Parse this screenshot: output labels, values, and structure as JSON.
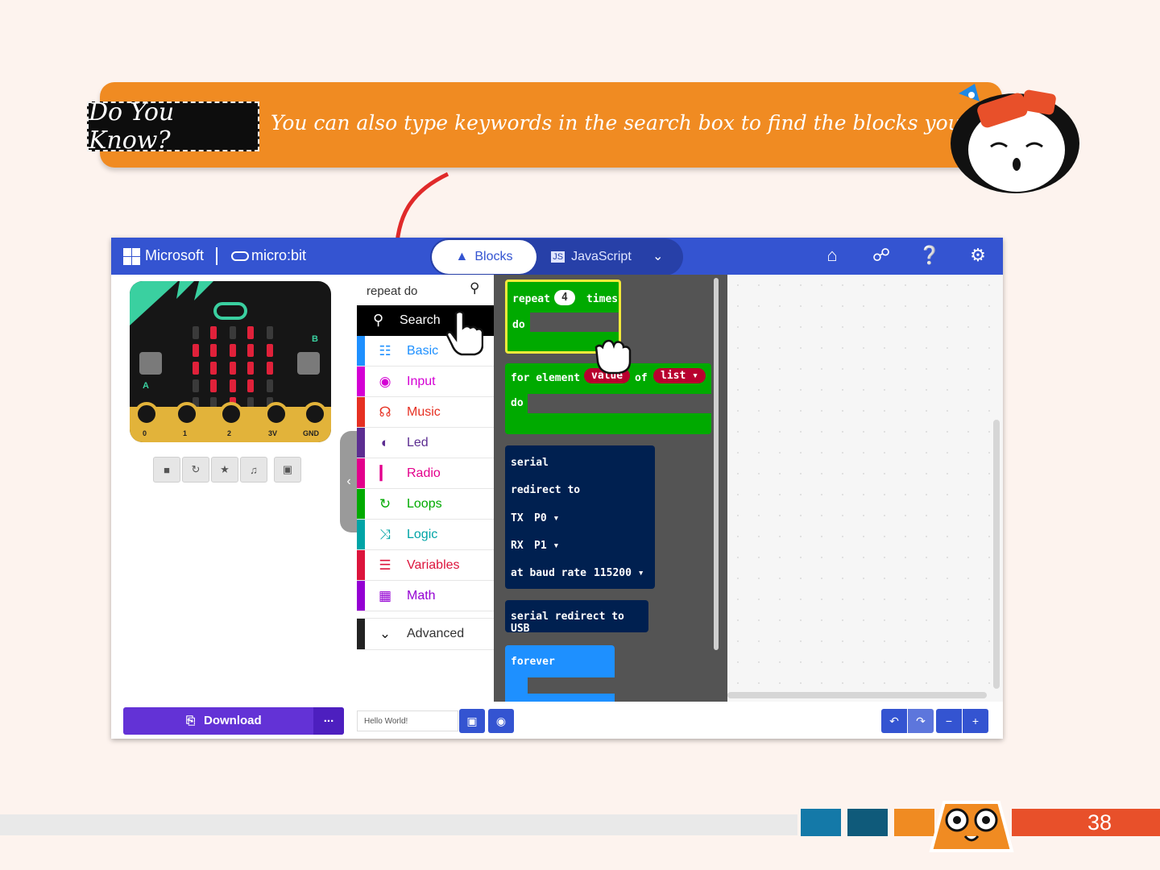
{
  "tip": {
    "label": "Do You Know?",
    "text": "You can also type keywords in the search box to find the blocks you need."
  },
  "header": {
    "brand": "Microsoft",
    "product": "micro:bit",
    "tabs": [
      "Blocks",
      "JavaScript"
    ],
    "active_tab": "Blocks"
  },
  "search": {
    "value": "repeat do",
    "button_label": "Search"
  },
  "toolbox": [
    {
      "label": "Basic",
      "color": "#1e90ff",
      "icon": "grid-icon"
    },
    {
      "label": "Input",
      "color": "#d400d4",
      "icon": "target-icon"
    },
    {
      "label": "Music",
      "color": "#e63022",
      "icon": "headphones-icon"
    },
    {
      "label": "Led",
      "color": "#5c2d91",
      "icon": "toggle-icon"
    },
    {
      "label": "Radio",
      "color": "#e3008c",
      "icon": "signal-icon"
    },
    {
      "label": "Loops",
      "color": "#00aa00",
      "icon": "refresh-icon"
    },
    {
      "label": "Logic",
      "color": "#00a4a6",
      "icon": "shuffle-icon"
    },
    {
      "label": "Variables",
      "color": "#dc143c",
      "icon": "lines-icon"
    },
    {
      "label": "Math",
      "color": "#9400d3",
      "icon": "calculator-icon"
    }
  ],
  "advanced_label": "Advanced",
  "blocks": {
    "repeat": {
      "word": "repeat",
      "count": "4",
      "times": "times",
      "do": "do"
    },
    "for_element": {
      "for": "for element",
      "var": "value",
      "of": "of",
      "list": "list",
      "do": "do"
    },
    "serial": {
      "l1": "serial",
      "l2": "redirect to",
      "tx": "TX",
      "tx_val": "P0",
      "rx": "RX",
      "rx_val": "P1",
      "baud": "at baud rate",
      "baud_val": "115200"
    },
    "serial_usb": "serial redirect to USB",
    "forever": "forever"
  },
  "microbit": {
    "pins": [
      "0",
      "1",
      "2",
      "3V",
      "GND"
    ],
    "button_a": "A",
    "button_b": "B"
  },
  "bottom": {
    "download_label": "Download",
    "more_label": "...",
    "project_name": "Hello World!"
  },
  "page_number": "38",
  "colors": {
    "accent": "#3454d1",
    "banner": "#f08b22",
    "loops": "#00aa00",
    "serial": "#002050",
    "basic": "#1e90ff"
  }
}
